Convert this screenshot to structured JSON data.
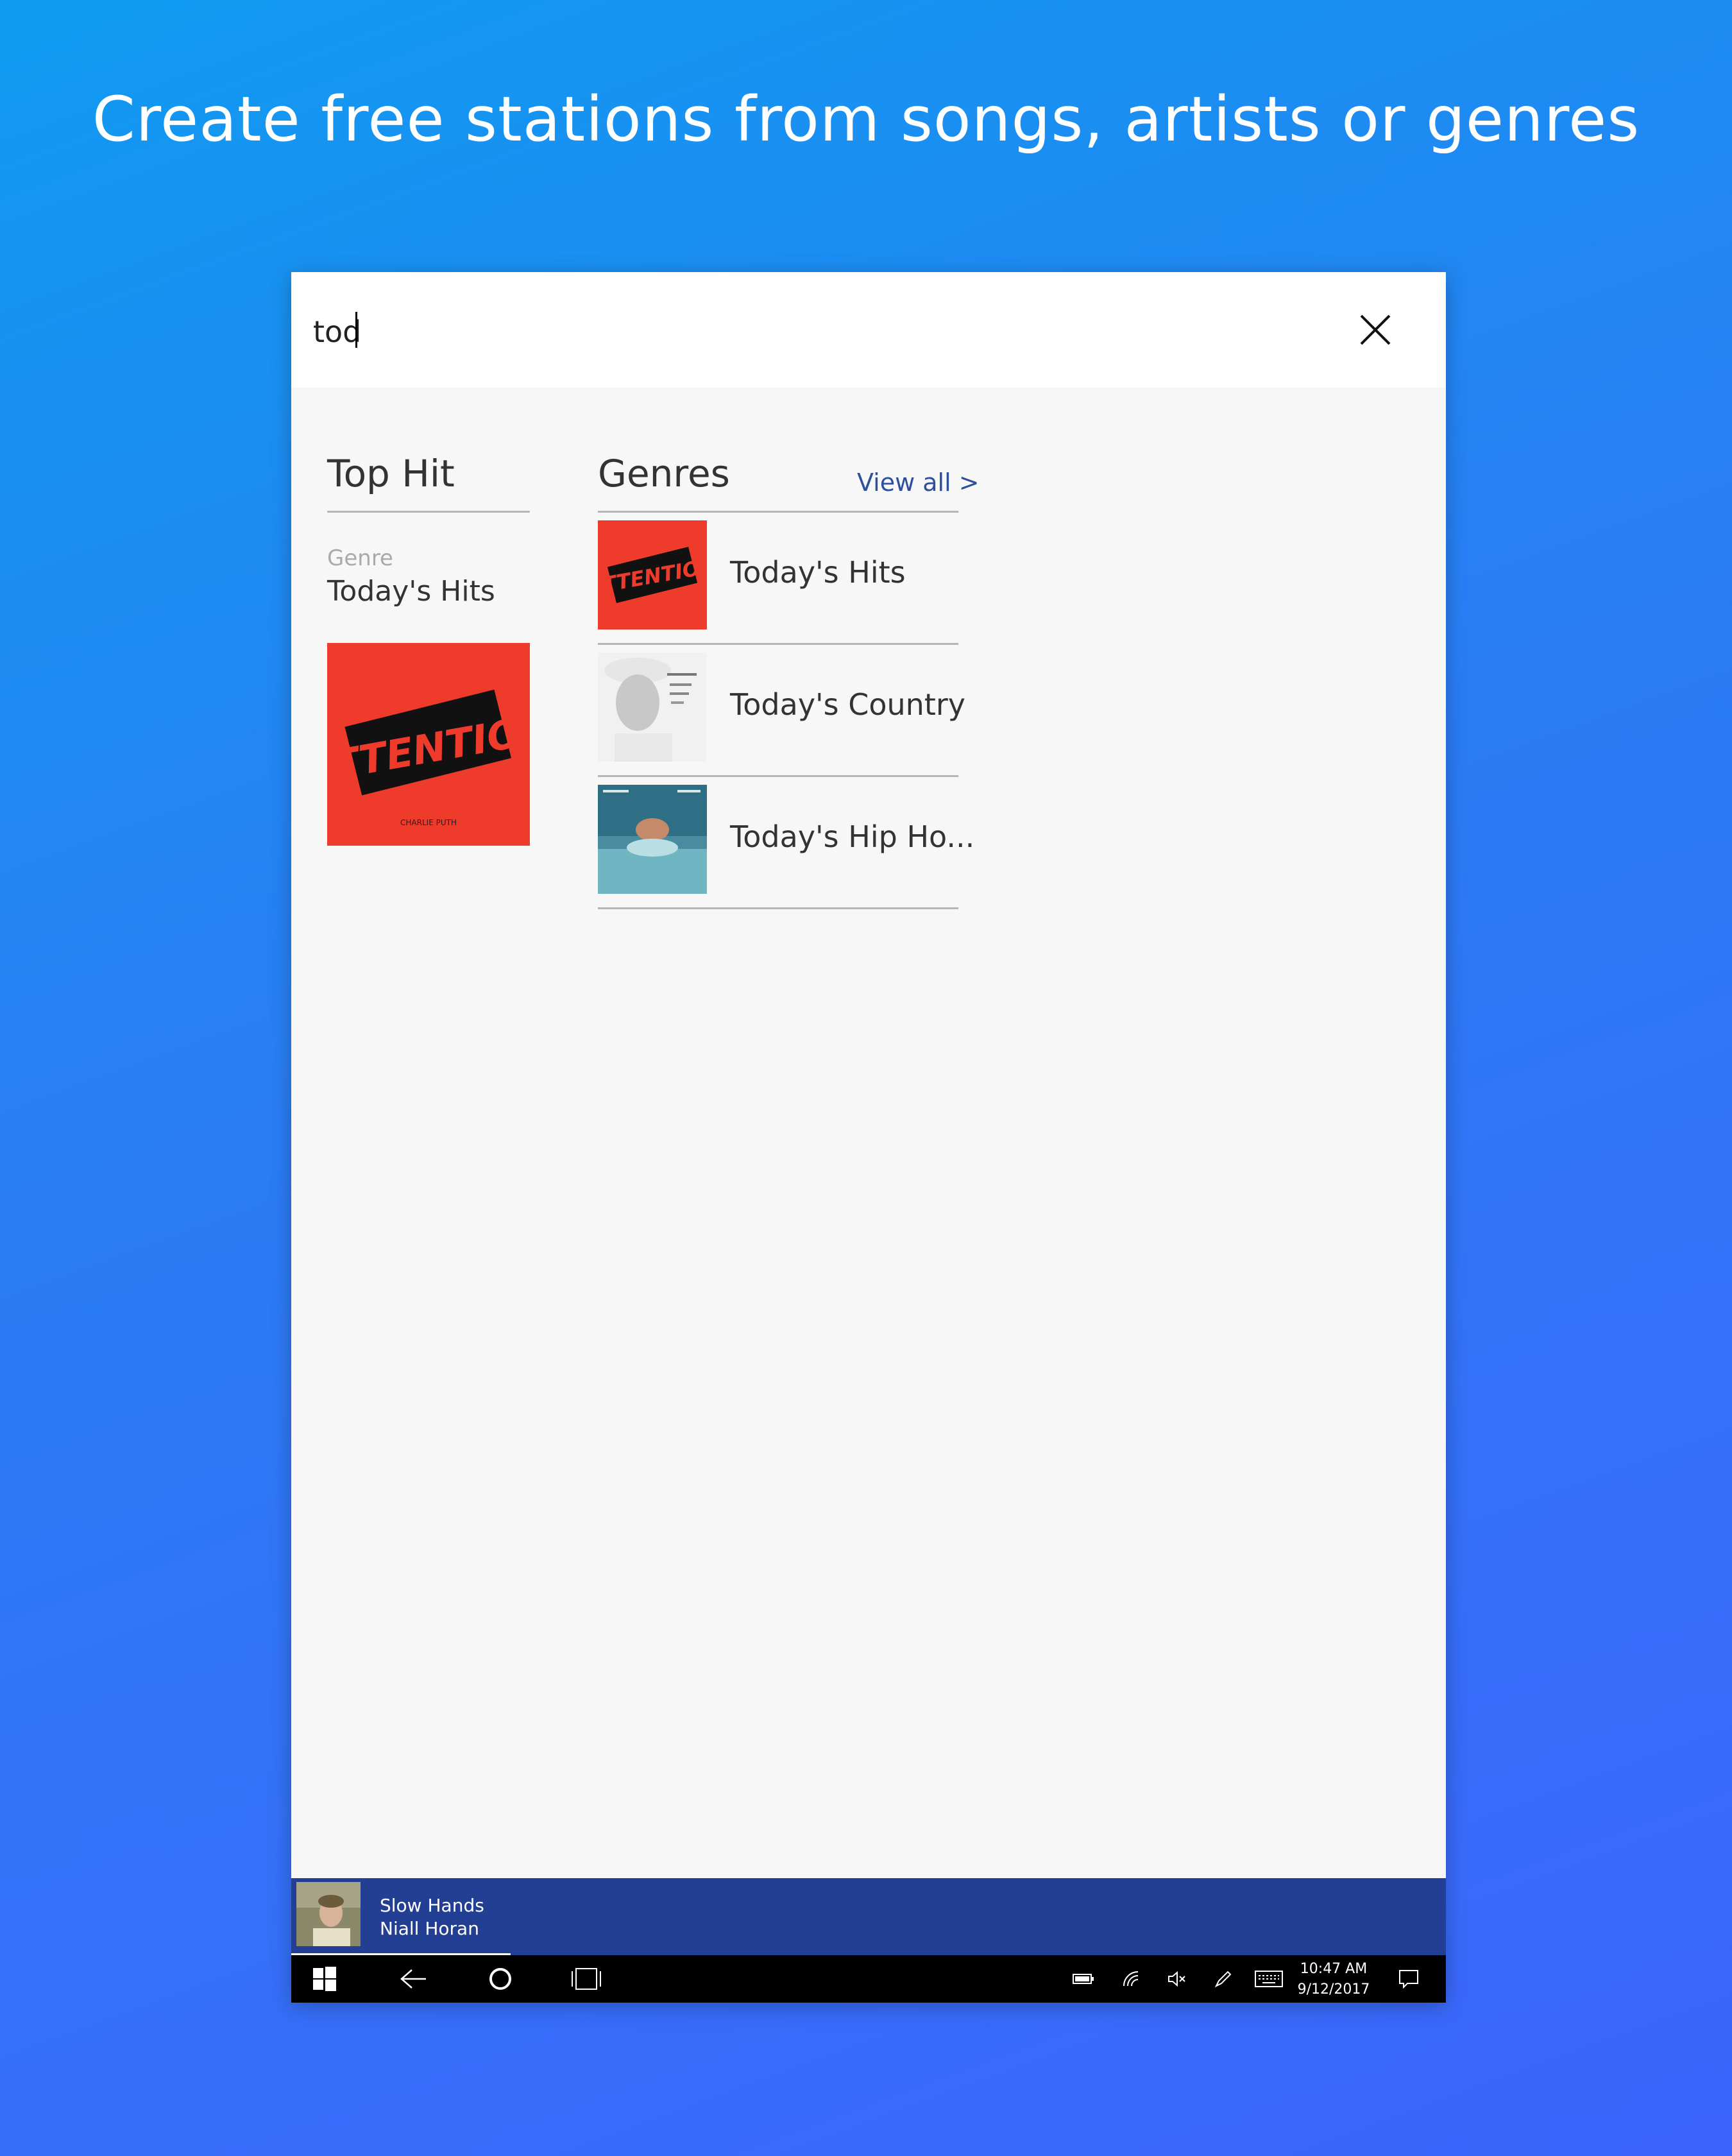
{
  "headline": "Create free stations from songs, artists or genres",
  "search": {
    "value": "tod",
    "close_icon": "close-icon"
  },
  "top_hit": {
    "section_title": "Top Hit",
    "type_label": "Genre",
    "name": "Today's Hits",
    "art": {
      "text": "ATTENTION",
      "subtext": "CHARLIE PUTH",
      "bg": "#ef3b2c"
    }
  },
  "genres": {
    "section_title": "Genres",
    "view_all": "View all >",
    "items": [
      {
        "label": "Today's Hits",
        "art": "attention-cover"
      },
      {
        "label": "Today's Country",
        "art": "portrait-cover"
      },
      {
        "label": "Today's Hip Ho...",
        "art": "baby-swim-cover"
      }
    ]
  },
  "now_playing": {
    "title": "Slow Hands",
    "artist": "Niall Horan",
    "progress": 0.19
  },
  "taskbar": {
    "time": "10:47 AM",
    "date": "9/12/2017",
    "icons": [
      "windows-icon",
      "back-arrow-icon",
      "cortana-icon",
      "task-view-icon",
      "battery-icon",
      "wifi-icon",
      "mute-icon",
      "pen-icon",
      "keyboard-icon",
      "notification-icon"
    ]
  },
  "colors": {
    "accent": "#2d4f9e",
    "now_playing_bg": "#233f94",
    "attention_red": "#ef3b2c"
  }
}
